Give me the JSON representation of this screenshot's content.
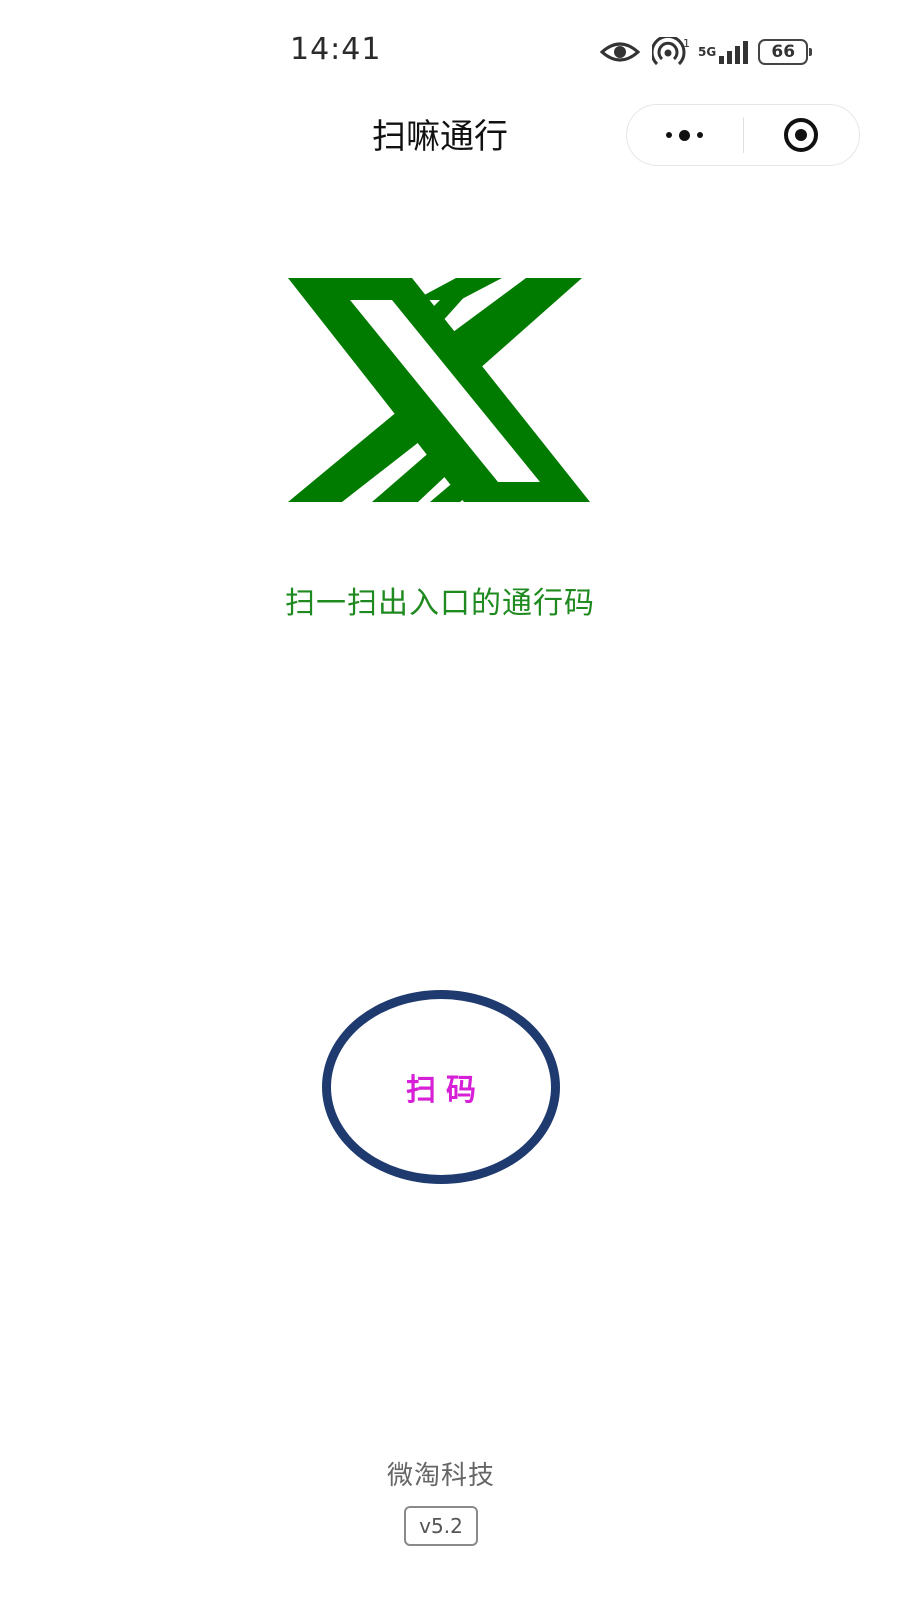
{
  "status_bar": {
    "time": "14:41",
    "icons": [
      "eye-icon",
      "hotspot-icon",
      "signal-icon",
      "battery-icon"
    ],
    "hotspot_count": "1",
    "network_type": "5G",
    "battery_level": "66"
  },
  "nav": {
    "title": "扫嘛通行",
    "more_icon": "more-dots-icon",
    "close_icon": "target-icon"
  },
  "logo": {
    "icon": "x-logo-icon",
    "color": "#007b00"
  },
  "tagline": "扫一扫出入口的通行码",
  "scan_button": {
    "label": "扫码",
    "border_color": "#1e3a6e",
    "label_color": "#d61fd6"
  },
  "footer": {
    "company": "微淘科技",
    "version": "v5.2"
  }
}
